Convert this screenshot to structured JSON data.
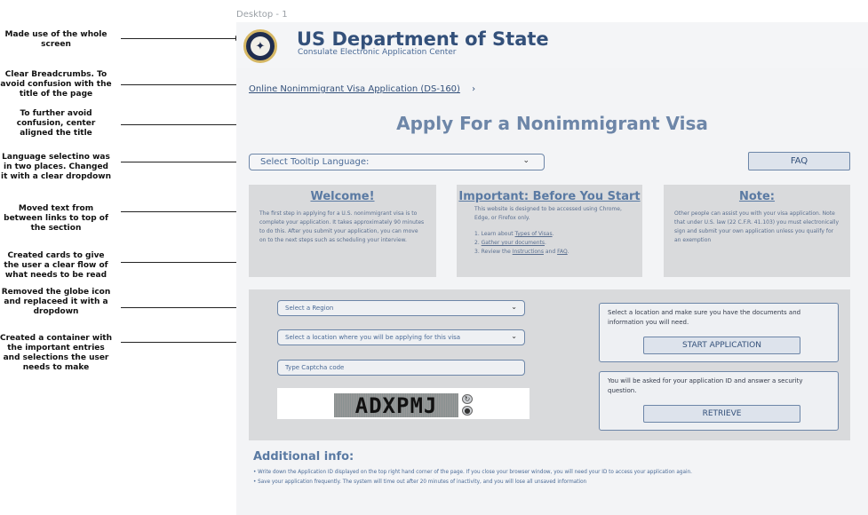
{
  "annotations": [
    {
      "text": "Made use of the whole screen"
    },
    {
      "text": "Clear Breadcrumbs. To avoid confusion with the title of the page"
    },
    {
      "text": "To further avoid confusion, center aligned the title"
    },
    {
      "text": "Language selectino was in two places. Changed it with a clear dropdown"
    },
    {
      "text": "Moved text from between links to top of the section"
    },
    {
      "text": "Created cards to give the user a clear flow of what needs to be read"
    },
    {
      "text": "Removed the globe icon and replaceed it with a dropdown"
    },
    {
      "text": "Created a container with the important entries and selections the user needs to make"
    }
  ],
  "frame_label": "Desktop - 1",
  "header": {
    "seal_icon": "dos-seal-icon",
    "title": "US Department of State",
    "subtitle": "Consulate Electronic Application Center"
  },
  "breadcrumb": {
    "link": "Online Nonimmigrant Visa Application (DS-160)",
    "separator": "›"
  },
  "page_title": "Apply For a Nonimmigrant Visa",
  "language_select": {
    "label": "Select Tooltip Language:",
    "chevron": "⌄"
  },
  "faq_button": "FAQ",
  "cards": {
    "welcome": {
      "title": "Welcome!",
      "body": "The first step in applying for a U.S. nonimmigrant visa is to complete your application. It takes approximately 90 minutes to do this. After you submit your application, you can move on to the next steps such as scheduling your interview."
    },
    "important": {
      "title": "Important: Before You Start",
      "body": "This website is designed to be accessed using Chrome, Edge, or Firefox only.",
      "steps": [
        {
          "prefix": "1. Learn about ",
          "link": "Types of Visas",
          "suffix": "."
        },
        {
          "prefix": "2. ",
          "link": "Gather your documents",
          "suffix": "."
        },
        {
          "prefix": "3. Review the ",
          "link": "Instructions",
          "mid": " and ",
          "link2": "FAQ",
          "suffix": "."
        }
      ]
    },
    "note": {
      "title": "Note:",
      "body": "Other people can assist you with your visa application. Note that under U.S. law (22 C.F.R. 41.103) you must electronically sign and submit your own application unless you qualify for an exemption"
    }
  },
  "form": {
    "region_placeholder": "Select a Region",
    "location_placeholder": "Select a location where you will be applying for this visa",
    "captcha_placeholder": "Type Captcha code",
    "captcha_text": "ADXPMJ",
    "refresh_icon": "refresh-icon",
    "audio_icon": "audio-icon"
  },
  "start_box": {
    "text": "Select a location and make sure you have the documents and information you will need.",
    "button": "START APPLICATION"
  },
  "retrieve_box": {
    "text": "You will be asked for your application ID and answer a security question.",
    "button": "RETRIEVE"
  },
  "additional_info": {
    "title": "Additional info:",
    "lines": [
      "• Write down the Application ID displayed on the top right hand corner of the page. If you close your browser window, you will need your ID to access your application again.",
      "• Save your application frequently. The system will time out after 20 minutes of inactivity, and you will lose all unsaved information"
    ]
  }
}
